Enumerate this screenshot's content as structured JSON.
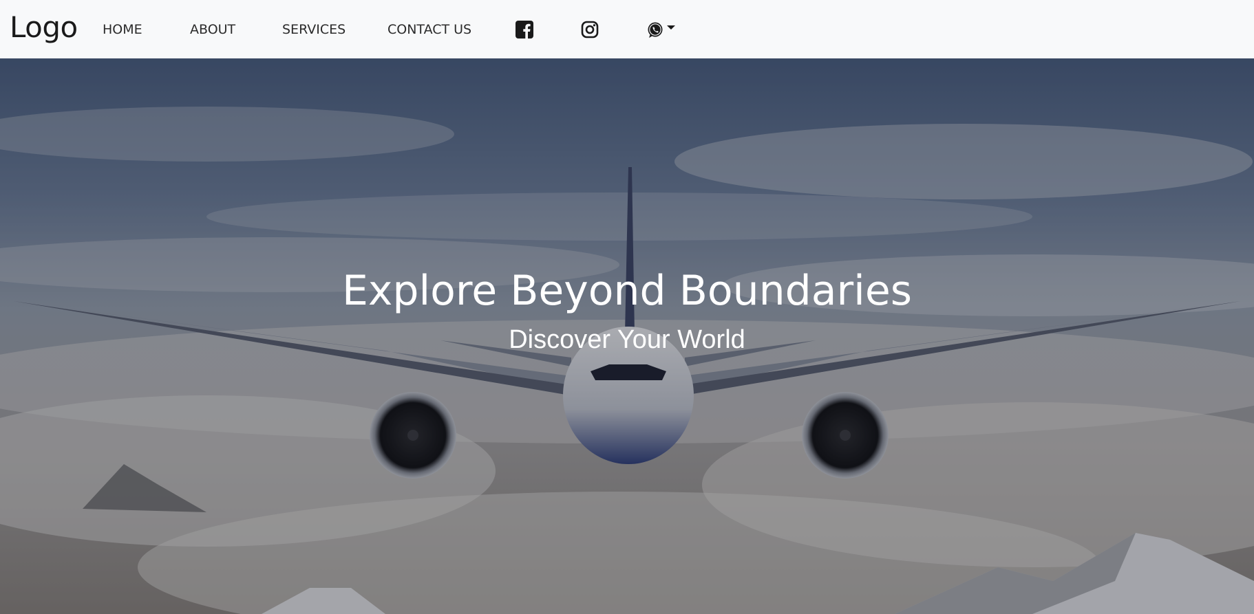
{
  "navbar": {
    "brand": "Logo",
    "links": [
      {
        "label": "HOME"
      },
      {
        "label": "ABOUT"
      },
      {
        "label": "SERVICES"
      },
      {
        "label": "CONTACT US"
      }
    ],
    "social": [
      {
        "icon": "facebook-icon"
      },
      {
        "icon": "instagram-icon"
      },
      {
        "icon": "whatsapp-icon",
        "has_dropdown": true
      }
    ]
  },
  "hero": {
    "title": "Explore Beyond Boundaries",
    "subtitle": "Discover Your World",
    "background": "airplane-above-clouds-photo"
  },
  "colors": {
    "navbar_bg": "#f8f9fa",
    "nav_text": "#2b2b2b",
    "hero_text": "#ffffff",
    "icon": "#1a1a1a"
  }
}
